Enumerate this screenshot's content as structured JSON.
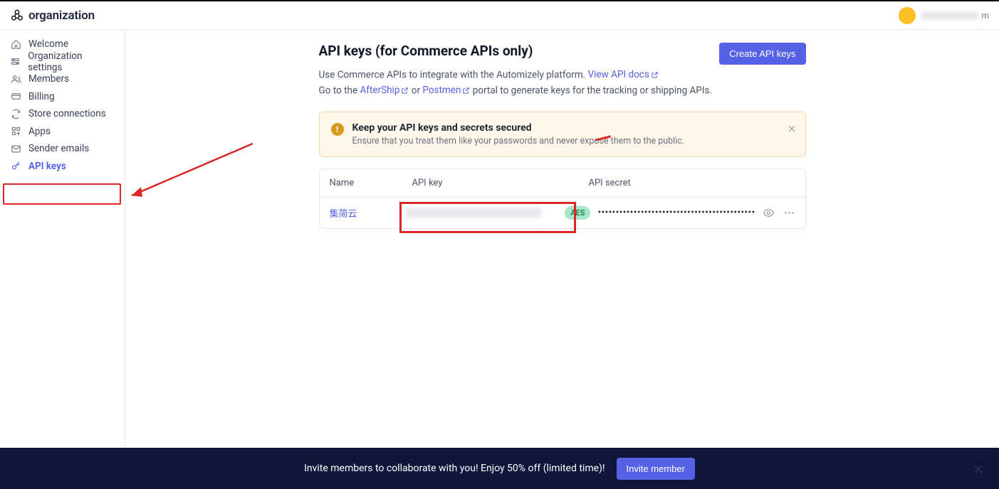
{
  "brand": {
    "name": "organization"
  },
  "user": {
    "suffix": "m"
  },
  "sidebar": {
    "items": [
      {
        "label": "Welcome",
        "icon": "home-icon",
        "active": false
      },
      {
        "label": "Organization settings",
        "icon": "gear-icon",
        "active": false
      },
      {
        "label": "Members",
        "icon": "users-icon",
        "active": false
      },
      {
        "label": "Billing",
        "icon": "card-icon",
        "active": false
      },
      {
        "label": "Store connections",
        "icon": "sync-icon",
        "active": false
      },
      {
        "label": "Apps",
        "icon": "grid-icon",
        "active": false
      },
      {
        "label": "Sender emails",
        "icon": "mail-icon",
        "active": false
      },
      {
        "label": "API keys",
        "icon": "key-icon",
        "active": true
      }
    ]
  },
  "page": {
    "title": "API keys (for Commerce APIs only)",
    "create_btn": "Create API keys",
    "desc_line1_a": "Use Commerce APIs to integrate with the Automizely platform. ",
    "desc_line1_link": "View API docs",
    "desc_line2_a": "Go to the ",
    "desc_line2_link1": "AfterShip",
    "desc_line2_or": "  or ",
    "desc_line2_link2": "Postmen",
    "desc_line2_b": "  portal to generate keys for the tracking or shipping APIs."
  },
  "alert": {
    "title": "Keep your API keys and secrets secured",
    "text": "Ensure that you treat them like your passwords and never expose them to the public."
  },
  "table": {
    "head": {
      "name": "Name",
      "key": "API key",
      "secret": "API secret"
    },
    "row": {
      "name": "集简云",
      "secret_badge": "AES",
      "secret_dots": "••••••••••••••••••••••••••••••••••••••••••••"
    }
  },
  "footer": {
    "text": "Invite members to collaborate with you! Enjoy 50% off (limited time)!",
    "btn": "Invite member"
  }
}
